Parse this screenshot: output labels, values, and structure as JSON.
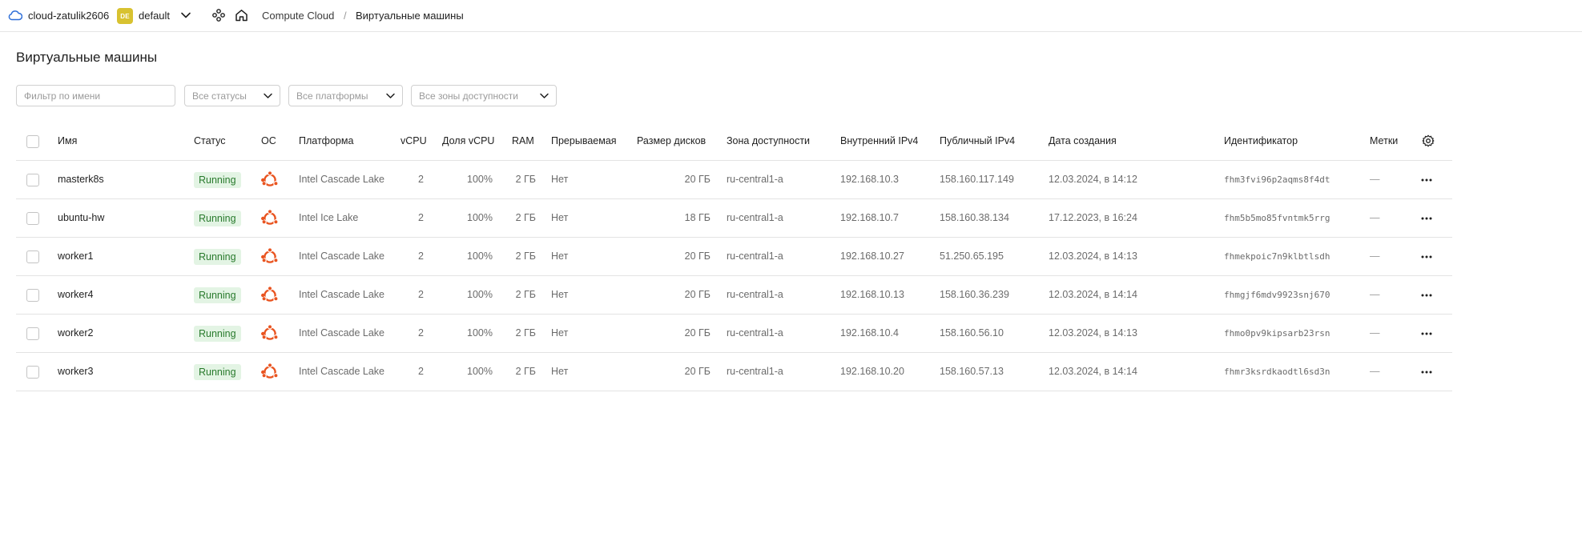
{
  "topbar": {
    "cloud_name": "cloud-zatulik2606",
    "folder_badge": "DE",
    "folder_name": "default",
    "service": "Compute Cloud",
    "separator": "/",
    "current": "Виртуальные машины"
  },
  "page": {
    "title": "Виртуальные машины"
  },
  "filters": {
    "name_placeholder": "Фильтр по имени",
    "status_label": "Все статусы",
    "platform_label": "Все платформы",
    "zone_label": "Все зоны доступности"
  },
  "table": {
    "columns": {
      "name": "Имя",
      "status": "Статус",
      "os": "ОС",
      "platform": "Платформа",
      "vcpu": "vCPU",
      "vcpu_share": "Доля vCPU",
      "ram": "RAM",
      "preemptible": "Прерываемая",
      "disk_size": "Размер дисков",
      "zone": "Зона доступности",
      "internal_ip": "Внутренний IPv4",
      "public_ip": "Публичный IPv4",
      "created": "Дата создания",
      "id": "Идентификатор",
      "labels": "Метки"
    },
    "rows": [
      {
        "name": "masterk8s",
        "status": "Running",
        "os_icon": "ubuntu-icon",
        "platform": "Intel Cascade Lake",
        "vcpu": "2",
        "vcpu_share": "100%",
        "ram": "2 ГБ",
        "preemptible": "Нет",
        "disk": "20 ГБ",
        "zone": "ru-central1-a",
        "internal_ip": "192.168.10.3",
        "public_ip": "158.160.117.149",
        "created": "12.03.2024, в 14:12",
        "id": "fhm3fvi96p2aqms8f4dt",
        "labels": "—"
      },
      {
        "name": "ubuntu-hw",
        "status": "Running",
        "os_icon": "ubuntu-icon",
        "platform": "Intel Ice Lake",
        "vcpu": "2",
        "vcpu_share": "100%",
        "ram": "2 ГБ",
        "preemptible": "Нет",
        "disk": "18 ГБ",
        "zone": "ru-central1-a",
        "internal_ip": "192.168.10.7",
        "public_ip": "158.160.38.134",
        "created": "17.12.2023, в 16:24",
        "id": "fhm5b5mo85fvntmk5rrg",
        "labels": "—"
      },
      {
        "name": "worker1",
        "status": "Running",
        "os_icon": "ubuntu-icon",
        "platform": "Intel Cascade Lake",
        "vcpu": "2",
        "vcpu_share": "100%",
        "ram": "2 ГБ",
        "preemptible": "Нет",
        "disk": "20 ГБ",
        "zone": "ru-central1-a",
        "internal_ip": "192.168.10.27",
        "public_ip": "51.250.65.195",
        "created": "12.03.2024, в 14:13",
        "id": "fhmekpoic7n9klbtlsdh",
        "labels": "—"
      },
      {
        "name": "worker4",
        "status": "Running",
        "os_icon": "ubuntu-icon",
        "platform": "Intel Cascade Lake",
        "vcpu": "2",
        "vcpu_share": "100%",
        "ram": "2 ГБ",
        "preemptible": "Нет",
        "disk": "20 ГБ",
        "zone": "ru-central1-a",
        "internal_ip": "192.168.10.13",
        "public_ip": "158.160.36.239",
        "created": "12.03.2024, в 14:14",
        "id": "fhmgjf6mdv9923snj670",
        "labels": "—"
      },
      {
        "name": "worker2",
        "status": "Running",
        "os_icon": "ubuntu-icon",
        "platform": "Intel Cascade Lake",
        "vcpu": "2",
        "vcpu_share": "100%",
        "ram": "2 ГБ",
        "preemptible": "Нет",
        "disk": "20 ГБ",
        "zone": "ru-central1-a",
        "internal_ip": "192.168.10.4",
        "public_ip": "158.160.56.10",
        "created": "12.03.2024, в 14:13",
        "id": "fhmo0pv9kipsarb23rsn",
        "labels": "—"
      },
      {
        "name": "worker3",
        "status": "Running",
        "os_icon": "ubuntu-icon",
        "platform": "Intel Cascade Lake",
        "vcpu": "2",
        "vcpu_share": "100%",
        "ram": "2 ГБ",
        "preemptible": "Нет",
        "disk": "20 ГБ",
        "zone": "ru-central1-a",
        "internal_ip": "192.168.10.20",
        "public_ip": "158.160.57.13",
        "created": "12.03.2024, в 14:14",
        "id": "fhmr3ksrdkaodtl6sd3n",
        "labels": "—"
      }
    ]
  },
  "colors": {
    "badge_bg": "#e3f4e4",
    "badge_text": "#287a2c",
    "ubuntu_orange": "#e95420",
    "folder_badge": "#d8c230",
    "cloud_icon": "#2f6fd8"
  }
}
